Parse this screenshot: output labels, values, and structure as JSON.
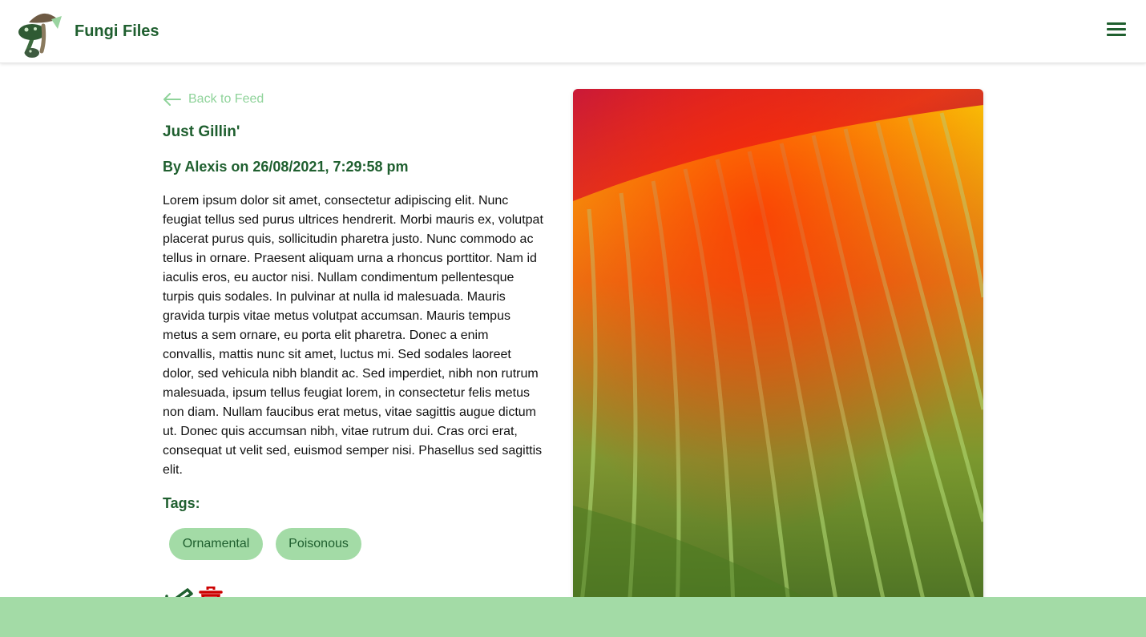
{
  "header": {
    "brand": "Fungi Files",
    "logo_icon": "mushroom-logo-icon",
    "menu_icon": "hamburger-menu-icon"
  },
  "post": {
    "back_label": "Back to Feed",
    "title": "Just Gillin'",
    "meta": "By Alexis on 26/08/2021, 7:29:58 pm",
    "body": "Lorem ipsum dolor sit amet, consectetur adipiscing elit. Nunc feugiat tellus sed purus ultrices hendrerit. Morbi mauris ex, volutpat placerat purus quis, sollicitudin pharetra justo. Nunc commodo ac tellus in ornare. Praesent aliquam urna a rhoncus porttitor. Nam id iaculis eros, eu auctor nisi. Nullam condimentum pellentesque turpis quis sodales. In pulvinar at nulla id malesuada. Mauris gravida turpis vitae metus volutpat accumsan. Mauris tempus metus a sem ornare, eu porta elit pharetra. Donec a enim convallis, mattis nunc sit amet, luctus mi. Sed sodales laoreet dolor, sed vehicula nibh blandit ac. Sed imperdiet, nibh non rutrum malesuada, ipsum tellus feugiat lorem, in consectetur felis metus non diam. Nullam faucibus erat metus, vitae sagittis augue dictum ut. Donec quis accumsan nibh, vitae rutrum dui. Cras orci erat, consequat ut velit sed, euismod semper nisi. Phasellus sed sagittis elit.",
    "tags_label": "Tags:",
    "tags": [
      "Ornamental",
      "Poisonous"
    ],
    "edit_icon": "edit-icon",
    "delete_icon": "trash-icon"
  },
  "colors": {
    "brand_green": "#1f5f2f",
    "light_green": "#a3dba6",
    "link_green": "#8fd39a",
    "delete_red": "#cc0000"
  }
}
